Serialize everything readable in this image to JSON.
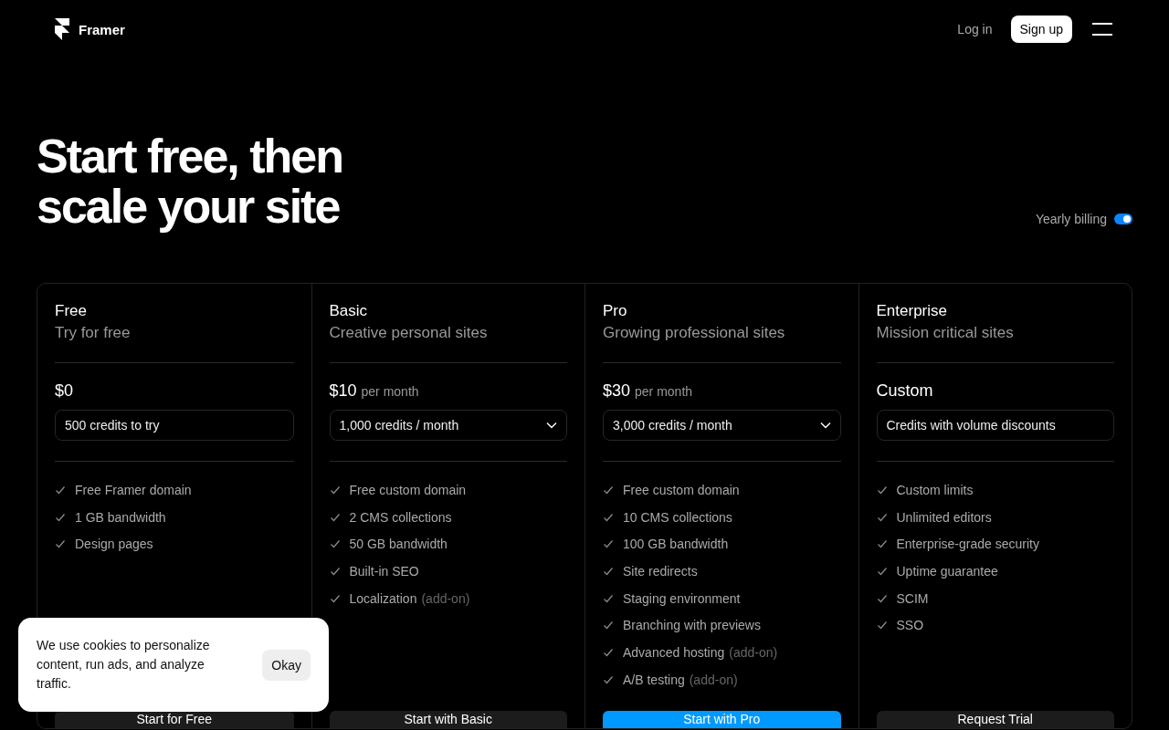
{
  "nav": {
    "brand": "Framer",
    "login": "Log in",
    "signup": "Sign up"
  },
  "hero": {
    "title_lines": [
      "Start free, then",
      "scale your site"
    ]
  },
  "billing": {
    "label": "Yearly billing",
    "on": true
  },
  "plans": [
    {
      "name": "Free",
      "tagline": "Try for free",
      "price": "$0",
      "credits": "500 credits to try",
      "dropdown": false,
      "features": [
        {
          "text": "Free Framer domain"
        },
        {
          "text": "1 GB bandwidth"
        },
        {
          "text": "Design pages"
        }
      ],
      "cta": "Start for Free",
      "highlight": false
    },
    {
      "name": "Basic",
      "tagline": "Creative personal sites",
      "price": "$10",
      "period": "per month",
      "credits": "1,000 credits / month",
      "dropdown": true,
      "features": [
        {
          "text": "Free custom domain"
        },
        {
          "text": "2 CMS collections"
        },
        {
          "text": "50 GB bandwidth"
        },
        {
          "text": "Built-in SEO"
        },
        {
          "text": "Localization",
          "note": "(add-on)"
        }
      ],
      "cta": "Start with Basic",
      "highlight": false
    },
    {
      "name": "Pro",
      "tagline": "Growing professional sites",
      "price": "$30",
      "period": "per month",
      "credits": "3,000 credits / month",
      "dropdown": true,
      "features": [
        {
          "text": "Free custom domain"
        },
        {
          "text": "10 CMS collections"
        },
        {
          "text": "100 GB bandwidth"
        },
        {
          "text": "Site redirects"
        },
        {
          "text": "Staging environment"
        },
        {
          "text": "Branching with previews"
        },
        {
          "text": "Advanced hosting",
          "note": "(add-on)"
        },
        {
          "text": "A/B testing",
          "note": "(add-on)"
        }
      ],
      "cta": "Start with Pro",
      "highlight": true
    },
    {
      "name": "Enterprise",
      "tagline": "Mission critical sites",
      "price": "Custom",
      "credits": "Credits with volume discounts",
      "dropdown": false,
      "features": [
        {
          "text": "Custom limits"
        },
        {
          "text": "Unlimited editors"
        },
        {
          "text": "Enterprise-grade security"
        },
        {
          "text": "Uptime guarantee"
        },
        {
          "text": "SCIM"
        },
        {
          "text": "SSO"
        }
      ],
      "cta": "Request Trial",
      "highlight": false
    }
  ],
  "cookie_banner": {
    "message": "We use cookies to personalize content, run ads, and analyze traffic.",
    "button": "Okay"
  }
}
